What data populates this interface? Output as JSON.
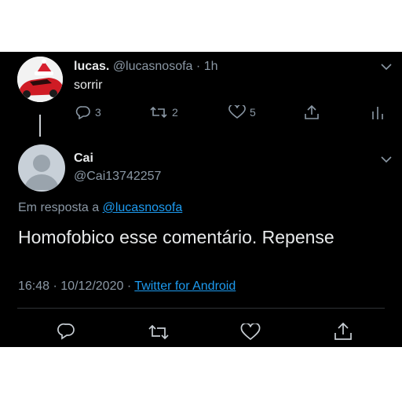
{
  "parent_tweet": {
    "display_name": "lucas.",
    "handle": "@lucasnosofa",
    "separator": "·",
    "time": "1h",
    "text": "sorrir",
    "replies": "3",
    "retweets": "2",
    "likes": "5"
  },
  "reply_tweet": {
    "display_name": "Cai",
    "handle": "@Cai13742257",
    "replying_prefix": "Em resposta a",
    "replying_to": "@lucasnosofa",
    "text": "Homofobico esse comentário. Repense",
    "time": "16:48",
    "date_separator": "·",
    "date": "10/12/2020",
    "source_separator": "·",
    "source": "Twitter for Android"
  },
  "colors": {
    "background": "#000000",
    "text": "#e7e9ea",
    "muted": "#8b98a5",
    "link": "#1d9bf0",
    "accent_red": "#e0245e"
  },
  "icons": [
    "chevron-down-icon",
    "reply-icon",
    "retweet-icon",
    "like-icon",
    "share-icon",
    "analytics-icon",
    "default-avatar-icon"
  ]
}
